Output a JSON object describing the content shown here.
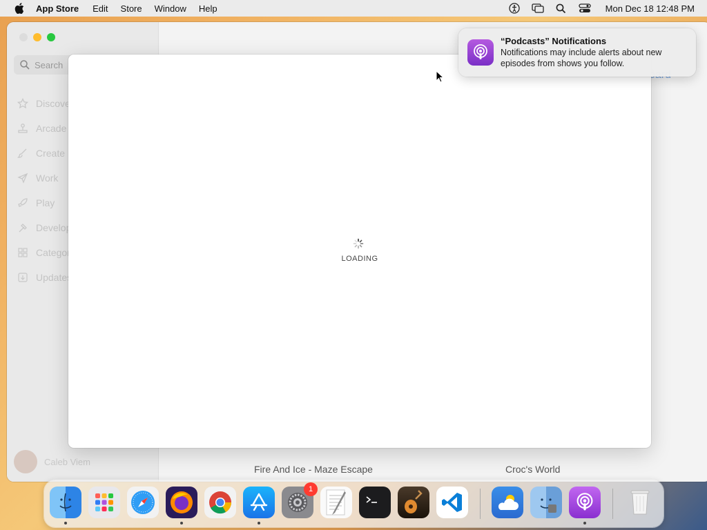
{
  "menubar": {
    "app_name": "App Store",
    "menus": [
      "Edit",
      "Store",
      "Window",
      "Help"
    ],
    "clock": "Mon Dec 18  12:48 PM"
  },
  "sidebar": {
    "search_placeholder": "Search",
    "items": [
      {
        "label": "Discover",
        "icon": "star-icon"
      },
      {
        "label": "Arcade",
        "icon": "joystick-icon"
      },
      {
        "label": "Create",
        "icon": "brush-icon"
      },
      {
        "label": "Work",
        "icon": "paper-plane-icon"
      },
      {
        "label": "Play",
        "icon": "rocket-icon"
      },
      {
        "label": "Develop",
        "icon": "hammer-icon"
      },
      {
        "label": "Categories",
        "icon": "grid-icon"
      },
      {
        "label": "Updates",
        "icon": "download-icon"
      }
    ],
    "user_name": "Caleb Viem"
  },
  "content": {
    "footer_titles": [
      "Fire And Ice - Maze Escape",
      "Croc's World"
    ],
    "partial_link": "oard"
  },
  "sheet": {
    "loading_text": "LOADING"
  },
  "notification": {
    "title": "“Podcasts” Notifications",
    "body": "Notifications may include alerts about new episodes from shows you follow."
  },
  "dock": {
    "apps": [
      "Finder",
      "Launchpad",
      "Safari",
      "Firefox",
      "Chrome",
      "App Store",
      "System Settings",
      "TextEdit",
      "Terminal",
      "GarageBand",
      "Visual Studio Code",
      "Weather",
      "Migration Assistant",
      "Podcasts",
      "Trash"
    ],
    "settings_badge": "1"
  },
  "colors": {
    "accent_blue": "#2f7cf6",
    "podcast_purple": "#9b44d8",
    "badge_red": "#ff3b30"
  }
}
